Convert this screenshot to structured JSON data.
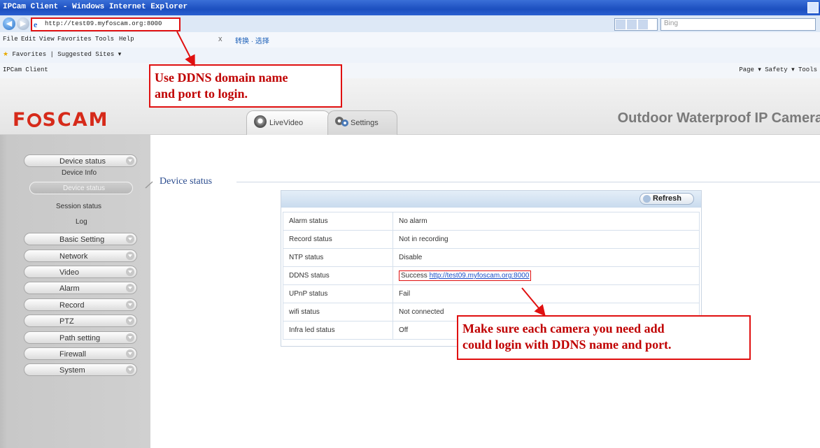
{
  "browser": {
    "title": "IPCam Client - Windows Internet Explorer",
    "url": "http://test09.myfoscam.org:8000",
    "search_placeholder": "Bing",
    "menu": [
      "File",
      "Edit",
      "View",
      "Favorites",
      "Tools",
      "Help"
    ],
    "close_x": "x",
    "chinese_toolbar": "转换 · 选择",
    "favorites_label": "Favorites",
    "suggested_sites": "Suggested Sites ▾",
    "tab_title": "IPCam Client",
    "toolbar_right": "Page ▾  Safety ▾  Tools"
  },
  "app": {
    "logo": "FOSCAM",
    "product_name": "Outdoor Waterproof IP Camera",
    "tabs": [
      {
        "label": "LiveVideo",
        "icon": "webcam-icon"
      },
      {
        "label": "Settings",
        "icon": "gears-icon"
      }
    ]
  },
  "sidebar": {
    "groups": [
      {
        "label": "Device status"
      },
      {
        "label": "Basic Setting"
      },
      {
        "label": "Network"
      },
      {
        "label": "Video"
      },
      {
        "label": "Alarm"
      },
      {
        "label": "Record"
      },
      {
        "label": "PTZ"
      },
      {
        "label": "Path setting"
      },
      {
        "label": "Firewall"
      },
      {
        "label": "System"
      }
    ],
    "device_status_items": [
      "Device Info",
      "Device status",
      "Session status",
      "Log"
    ],
    "active_item": "Device status"
  },
  "main": {
    "section_title": "Device status",
    "refresh_label": "Refresh",
    "rows": [
      {
        "key": "Alarm status",
        "value": "No alarm"
      },
      {
        "key": "Record status",
        "value": "Not in recording"
      },
      {
        "key": "NTP status",
        "value": "Disable"
      },
      {
        "key": "DDNS status",
        "value": "Success",
        "link": "http://test09.myfoscam.org:8000"
      },
      {
        "key": "UPnP status",
        "value": "Fail"
      },
      {
        "key": "wifi status",
        "value": "Not connected"
      },
      {
        "key": "Infra led status",
        "value": "Off"
      }
    ]
  },
  "annotations": {
    "callout1": [
      "Use DDNS domain name",
      "and port to login."
    ],
    "callout2": [
      "Make sure each camera you need add",
      "could login with DDNS name and port."
    ],
    "color": "#e01010"
  }
}
